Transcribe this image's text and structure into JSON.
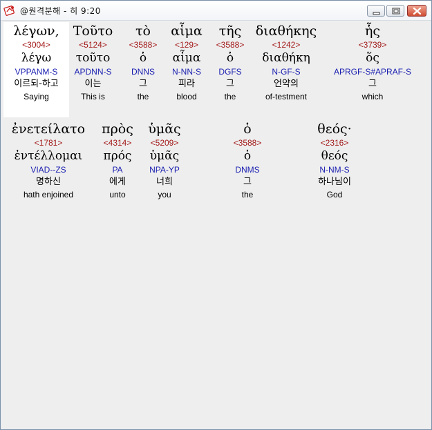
{
  "window": {
    "title": "@원격분해 - 히 9:20"
  },
  "lines": [
    {
      "words": [
        {
          "greek": "λέγων,",
          "strong": "<3004>",
          "lemma": "λέγω",
          "parsing": "VPPANM-S",
          "korean": "이르되-하고",
          "english": "Saying"
        },
        {
          "greek": "Τοῦτο",
          "strong": "<5124>",
          "lemma": "τοῦτο",
          "parsing": "APDNN-S",
          "korean": "이는",
          "english": "This is"
        },
        {
          "greek": "τὸ",
          "strong": "<3588>",
          "lemma": "ὁ",
          "parsing": "DNNS",
          "korean": "그",
          "english": "the"
        },
        {
          "greek": "αἷμα",
          "strong": "<129>",
          "lemma": "αἷμα",
          "parsing": "N-NN-S",
          "korean": "피라",
          "english": "blood"
        },
        {
          "greek": "τῆς",
          "strong": "<3588>",
          "lemma": "ὁ",
          "parsing": "DGFS",
          "korean": "그",
          "english": "the"
        },
        {
          "greek": "διαθήκης",
          "strong": "<1242>",
          "lemma": "διαθήκη",
          "parsing": "N-GF-S",
          "korean": "언약의",
          "english": "of-testment"
        },
        {
          "greek": "ἧς",
          "strong": "<3739>",
          "lemma": "ὅς",
          "parsing": "APRGF-S#APRAF-S",
          "korean": "그",
          "english": "which"
        }
      ]
    },
    {
      "words": [
        {
          "greek": "ἐνετείλατο",
          "strong": "<1781>",
          "lemma": "ἐντέλλομαι",
          "parsing": "VIAD--ZS",
          "korean": "명하신",
          "english": "hath enjoined"
        },
        {
          "greek": "πρὸς",
          "strong": "<4314>",
          "lemma": "πρός",
          "parsing": "PA",
          "korean": "에게",
          "english": "unto"
        },
        {
          "greek": "ὑμᾶς",
          "strong": "<5209>",
          "lemma": "ὑμᾶς",
          "parsing": "NPA-YP",
          "korean": "너희",
          "english": "you"
        },
        {
          "greek": "ὁ",
          "strong": "<3588>",
          "lemma": "ὁ",
          "parsing": "DNMS",
          "korean": "그",
          "english": "the"
        },
        {
          "greek": "θεός·",
          "strong": "<2316>",
          "lemma": "θεός",
          "parsing": "N-NM-S",
          "korean": "하나님이",
          "english": "God"
        }
      ]
    }
  ]
}
